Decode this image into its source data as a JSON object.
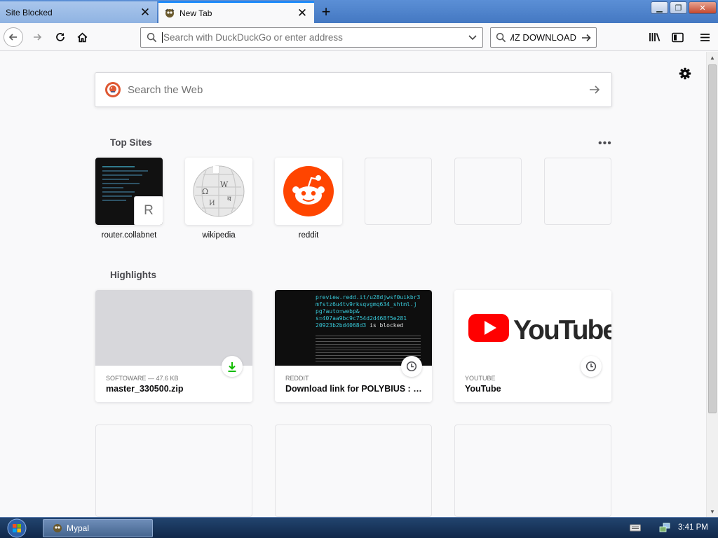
{
  "tabs": [
    {
      "label": "Site Blocked",
      "active": false
    },
    {
      "label": "New Tab",
      "active": true
    }
  ],
  "toolbar": {
    "url_placeholder": "Search with DuckDuckGo or enter address",
    "search_value": "MZ DOWNLOAD"
  },
  "web_search": {
    "placeholder": "Search the Web"
  },
  "sections": {
    "top_sites": "Top Sites",
    "highlights": "Highlights"
  },
  "top_sites": [
    {
      "label": "router.collabnet",
      "badge": "R"
    },
    {
      "label": "wikipedia"
    },
    {
      "label": "reddit"
    }
  ],
  "highlights": [
    {
      "context": "SOFTOWARE — 47.6 KB",
      "title": "master_330500.zip",
      "badge": "download-icon"
    },
    {
      "context": "REDDIT",
      "title": "Download link for POLYBIUS : arcade",
      "badge": "clock-icon"
    },
    {
      "context": "YOUTUBE",
      "title": "YouTube",
      "badge": "clock-icon"
    }
  ],
  "reddit_preview_lines": [
    "preview.redd.it/u28djwsf0uikbr3",
    "mfstz6u4tv9rksqvgmq634_shtml.j",
    "pg?auto=webp&",
    "s=407aa9bc9c754d2d468f5e281",
    "20923b2bd4068d3"
  ],
  "reddit_preview_suffix": "is blocked",
  "youtube_logo_text": "YouTube",
  "taskbar": {
    "app": "Mypal",
    "clock": "3:41 PM"
  },
  "colors": {
    "accent": "#0a84ff",
    "reddit": "#ff4500",
    "youtube": "#ff0000",
    "download": "#12bc00"
  }
}
